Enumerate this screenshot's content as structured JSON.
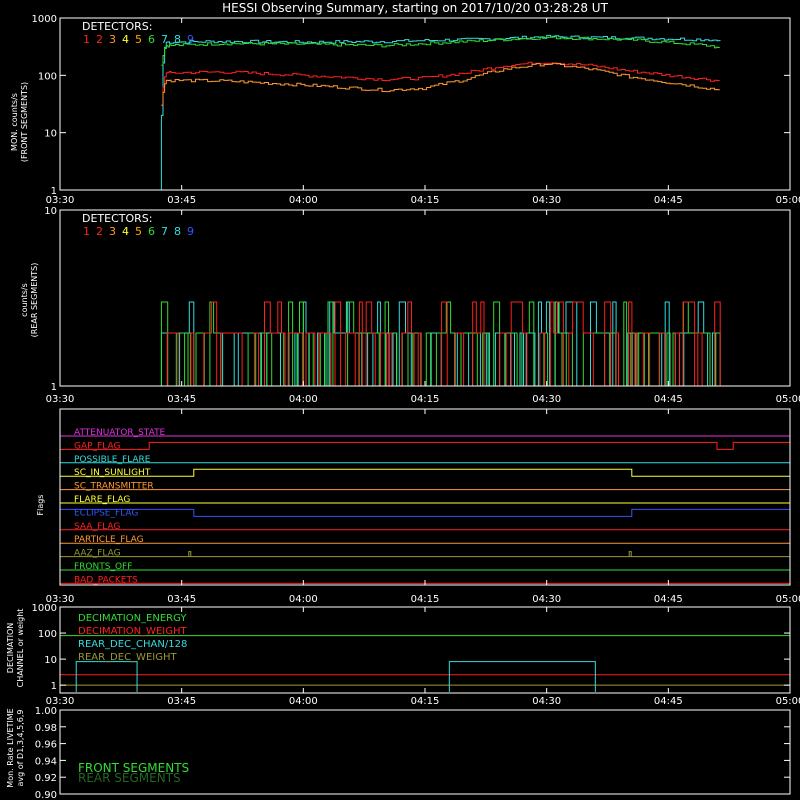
{
  "title": "HESSI Observing Summary, starting on 2017/10/20 03:28:28 UT",
  "time_ticks": [
    "03:30",
    "03:45",
    "04:00",
    "04:15",
    "04:30",
    "04:45",
    "05:00"
  ],
  "detector_colors": [
    "#ff2020",
    "#ff2020",
    "#ff9933",
    "#ffff33",
    "#ffa500",
    "#33dd33",
    "#33dddd",
    "#33dddd",
    "#3355ff"
  ],
  "chart_data": [
    {
      "type": "line",
      "title": "",
      "ylabel": "MON. counts/s (FRONT SEGMENTS)",
      "yscale": "log",
      "ylim": [
        1,
        1000
      ],
      "yticks": [
        "1",
        "10",
        "100",
        "1000"
      ],
      "legend_title": "DETECTORS:",
      "legend_items": [
        "1",
        "2",
        "3",
        "4",
        "5",
        "6",
        "7",
        "8",
        "9"
      ],
      "x_unit": "minutes after 03:30 UT",
      "series": [
        {
          "color": "#33dddd",
          "x": [
            12.3,
            12.5,
            13,
            20,
            30,
            40,
            50,
            60,
            70,
            80,
            81.4,
            81.6
          ],
          "y": [
            1,
            20,
            380,
            390,
            380,
            390,
            420,
            470,
            450,
            420,
            400,
            1
          ]
        },
        {
          "color": "#33dd33",
          "x": [
            12.5,
            13,
            20,
            30,
            40,
            50,
            60,
            70,
            80,
            81.4
          ],
          "y": [
            150,
            330,
            360,
            350,
            330,
            390,
            460,
            420,
            330,
            300
          ]
        },
        {
          "color": "#ff2020",
          "x": [
            12.5,
            13,
            20,
            30,
            40,
            45,
            50,
            55,
            60,
            65,
            70,
            75,
            81.4
          ],
          "y": [
            30,
            110,
            115,
            100,
            85,
            90,
            110,
            150,
            170,
            150,
            120,
            100,
            80
          ]
        },
        {
          "color": "#ff9933",
          "x": [
            12.5,
            13,
            20,
            30,
            40,
            45,
            50,
            55,
            60,
            65,
            70,
            75,
            81.4
          ],
          "y": [
            30,
            82,
            80,
            68,
            55,
            60,
            85,
            130,
            160,
            130,
            95,
            75,
            55
          ]
        }
      ]
    },
    {
      "type": "line",
      "title": "",
      "ylabel": "counts/s (REAR SEGMENTS)",
      "yscale": "log",
      "ylim": [
        1,
        10
      ],
      "yticks": [
        "1",
        "10"
      ],
      "legend_title": "DETECTORS:",
      "legend_items": [
        "1",
        "2",
        "3",
        "4",
        "5",
        "6",
        "7",
        "8",
        "9"
      ]
    },
    {
      "type": "line",
      "title": "",
      "ylabel": "Flags",
      "flags": [
        {
          "label": "ATTENUATOR_STATE",
          "color": "#dd33dd",
          "steps": []
        },
        {
          "label": "GAP_FLAG",
          "color": "#ff2020",
          "steps": [
            [
              0,
              0
            ],
            [
              11,
              1
            ],
            [
              80.5,
              1
            ],
            [
              81,
              0
            ],
            [
              83,
              1
            ],
            [
              90,
              1
            ]
          ]
        },
        {
          "label": "POSSIBLE_FLARE",
          "color": "#33dddd",
          "steps": []
        },
        {
          "label": "SC_IN_SUNLIGHT",
          "color": "#ffff33",
          "steps": [
            [
              0,
              0
            ],
            [
              16,
              0
            ],
            [
              16.5,
              1
            ],
            [
              70.3,
              1
            ],
            [
              70.5,
              0
            ],
            [
              90,
              0
            ]
          ]
        },
        {
          "label": "SC_TRANSMITTER",
          "color": "#ff9933",
          "steps": []
        },
        {
          "label": "FLARE_FLAG",
          "color": "#ffff33",
          "steps": []
        },
        {
          "label": "ECLIPSE_FLAG",
          "color": "#3355ff",
          "steps": [
            [
              0,
              1
            ],
            [
              16,
              1
            ],
            [
              16.5,
              0
            ],
            [
              70.3,
              0
            ],
            [
              70.5,
              1
            ],
            [
              90,
              1
            ]
          ]
        },
        {
          "label": "SAA_FLAG",
          "color": "#ff2020",
          "steps": []
        },
        {
          "label": "PARTICLE_FLAG",
          "color": "#ff9933",
          "steps": []
        },
        {
          "label": "AAZ_FLAG",
          "color": "#999933",
          "steps": []
        },
        {
          "label": "FRONTS_OFF",
          "color": "#33dd33",
          "steps": []
        },
        {
          "label": "BAD_PACKETS",
          "color": "#ff2020",
          "steps": []
        }
      ]
    },
    {
      "type": "line",
      "title": "",
      "ylabel": "DECIMATION CHANNEL or weight",
      "yscale": "log",
      "ylim": [
        0.5,
        1000
      ],
      "yticks": [
        "1",
        "10",
        "100",
        "1000"
      ],
      "series": [
        {
          "name": "DECIMATION_ENERGY",
          "color": "#33dd33",
          "value_label": "~80"
        },
        {
          "name": "DECIMATION_WEIGHT",
          "color": "#ff2020",
          "value_label": "~2.5"
        },
        {
          "name": "REAR_DEC_CHAN/128",
          "color": "#33dddd",
          "segments": [
            [
              2,
              9.5,
              8
            ],
            [
              48,
              66,
              8
            ],
            [
              90,
              94,
              8
            ]
          ]
        },
        {
          "name": "REAR_DEC_WEIGHT",
          "color": "#999933",
          "value_label": "~1"
        }
      ]
    },
    {
      "type": "line",
      "title": "",
      "ylabel": "Mon. Rate LIVETIME avg of D1,3,4,5,6,9",
      "ylim": [
        0.9,
        1.0
      ],
      "yticks": [
        "0.90",
        "0.92",
        "0.94",
        "0.96",
        "0.98",
        "1.00"
      ],
      "legend_items": [
        {
          "label": "FRONT SEGMENTS",
          "color": "#33dd33"
        },
        {
          "label": "REAR SEGMENTS",
          "color": "#226622"
        }
      ]
    }
  ]
}
